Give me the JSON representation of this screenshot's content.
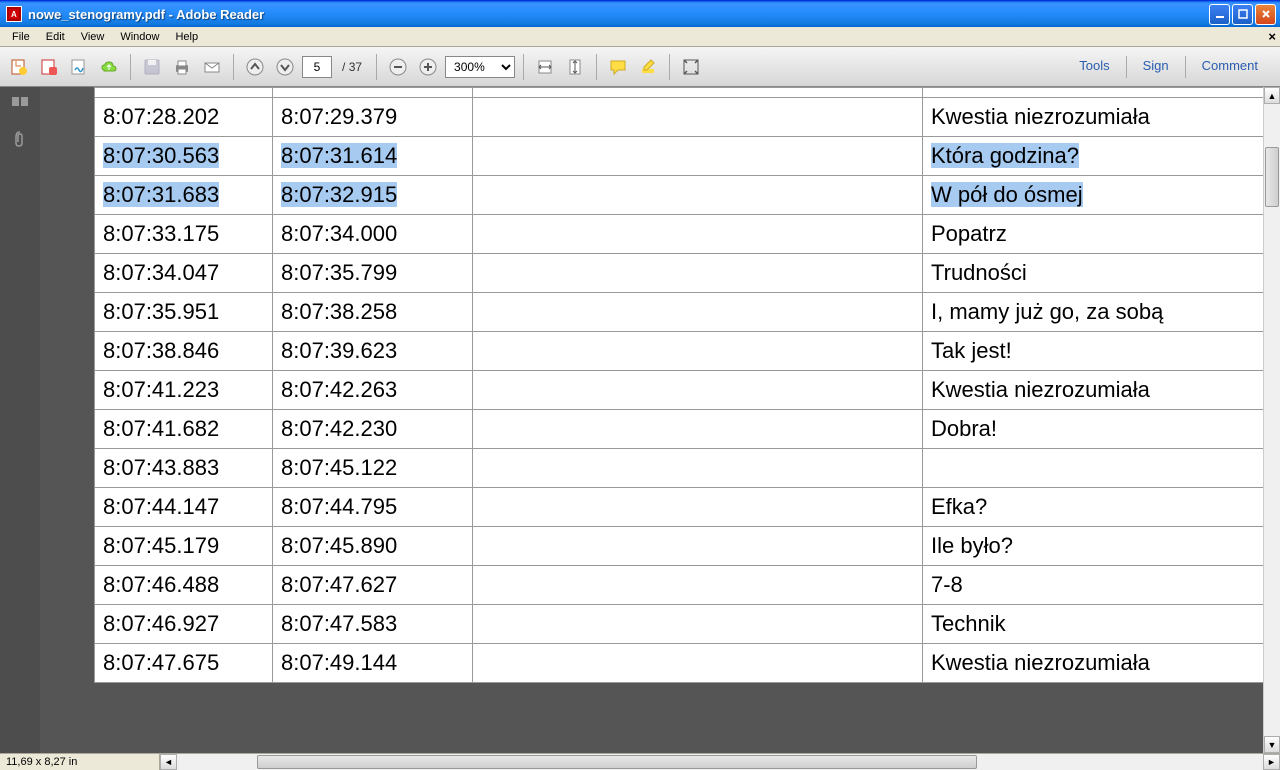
{
  "window": {
    "title": "nowe_stenogramy.pdf - Adobe Reader"
  },
  "menu": {
    "file": "File",
    "edit": "Edit",
    "view": "View",
    "window": "Window",
    "help": "Help"
  },
  "toolbar": {
    "page_current": "5",
    "page_sep": "/",
    "page_total": "37",
    "zoom": "300%",
    "tools": "Tools",
    "sign": "Sign",
    "comment": "Comment"
  },
  "status": {
    "dimensions": "11,69 x 8,27 in"
  },
  "rows": [
    {
      "t1": "8:07:28.202",
      "t2": "8:07:29.379",
      "c3": "",
      "c4": "Kwestia niezrozumiała",
      "muted": true,
      "sel": false,
      "h": ""
    },
    {
      "t1": "8:07:30.563",
      "t2": "8:07:31.614",
      "c3": "",
      "c4": "Która godzina?",
      "muted": false,
      "sel": true,
      "h": ""
    },
    {
      "t1": "8:07:31.683",
      "t2": "8:07:32.915",
      "c3": "",
      "c4": "W pół do ósmej",
      "muted": false,
      "sel": true,
      "h": ""
    },
    {
      "t1": "8:07:33.175",
      "t2": "8:07:34.000",
      "c3": "",
      "c4": "Popatrz",
      "muted": false,
      "sel": false,
      "h": ""
    },
    {
      "t1": "8:07:34.047",
      "t2": "8:07:35.799",
      "c3": "",
      "c4": "Trudności",
      "muted": false,
      "sel": false,
      "h": ""
    },
    {
      "t1": "8:07:35.951",
      "t2": "8:07:38.258",
      "c3": "",
      "c4": "I, mamy już go, za sobą",
      "muted": false,
      "sel": false,
      "h": ""
    },
    {
      "t1": "8:07:38.846",
      "t2": "8:07:39.623",
      "c3": "",
      "c4": "Tak jest!",
      "muted": false,
      "sel": false,
      "h": ""
    },
    {
      "t1": "8:07:41.223",
      "t2": "8:07:42.263",
      "c3": "",
      "c4": "Kwestia niezrozumiała",
      "muted": true,
      "sel": false,
      "h": ""
    },
    {
      "t1": "8:07:41.682",
      "t2": "8:07:42.230",
      "c3": "",
      "c4": "Dobra!",
      "muted": false,
      "sel": false,
      "h": ""
    },
    {
      "t1": "8:07:43.883",
      "t2": "8:07:45.122",
      "c3": "",
      "c4": "",
      "muted": false,
      "sel": false,
      "h": "tall"
    },
    {
      "t1": "8:07:44.147",
      "t2": "8:07:44.795",
      "c3": "",
      "c4": "Efka?",
      "muted": false,
      "sel": false,
      "h": ""
    },
    {
      "t1": "8:07:45.179",
      "t2": "8:07:45.890",
      "c3": "",
      "c4": "Ile było?",
      "muted": false,
      "sel": false,
      "h": "med"
    },
    {
      "t1": "8:07:46.488",
      "t2": "8:07:47.627",
      "c3": "",
      "c4": "7-8",
      "muted": false,
      "sel": false,
      "h": ""
    },
    {
      "t1": "8:07:46.927",
      "t2": "8:07:47.583",
      "c3": "",
      "c4": "Technik",
      "muted": false,
      "sel": false,
      "h": ""
    },
    {
      "t1": "8:07:47.675",
      "t2": "8:07:49.144",
      "c3": "",
      "c4": "Kwestia niezrozumiała",
      "muted": true,
      "sel": false,
      "h": ""
    }
  ]
}
